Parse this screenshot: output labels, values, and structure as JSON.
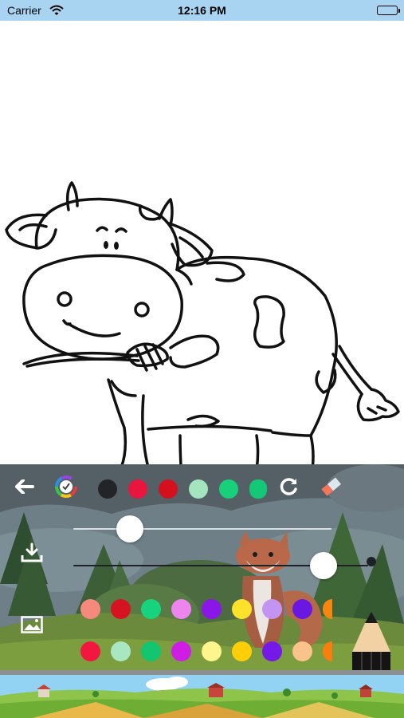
{
  "status_bar": {
    "carrier": "Carrier",
    "time": "12:16 PM",
    "battery_level": 1.0
  },
  "canvas": {
    "subject": "cow",
    "icon": "cow-coloring-outline"
  },
  "toolbar": {
    "back_icon": "arrow-left-icon",
    "color_wheel_icon": "color-wheel-icon",
    "redo_icon": "rotate-icon",
    "eraser_icon": "eraser-icon",
    "quick_colors": [
      "#222427",
      "#e8153f",
      "#d4101e",
      "#a4e4bf",
      "#16d17a",
      "#13c977"
    ]
  },
  "brush": {
    "size_value": 0.22,
    "opacity_value": 0.97
  },
  "side_buttons": {
    "save_icon": "download-icon",
    "gallery_icon": "image-icon"
  },
  "palette": {
    "row1": [
      "#f58a7c",
      "#d61421",
      "#18d37e",
      "#ee84ee",
      "#8a16e8",
      "#fde22b",
      "#c394f2",
      "#6a18e1",
      "#f7850e"
    ],
    "row2": [
      "#f2173f",
      "#a9e7c3",
      "#13c56f",
      "#cf1de6",
      "#fef58c",
      "#fecf08",
      "#7519e8",
      "#fbc38c",
      "#fb7d0c"
    ]
  },
  "pencil_tool": {
    "icon": "pencil-icon"
  },
  "banner": {
    "icon": "farm-landscape-banner"
  }
}
